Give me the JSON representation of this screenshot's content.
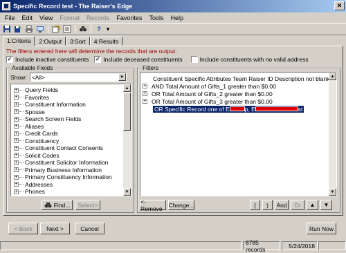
{
  "window": {
    "title": "Specific Record test - The Raiser's Edge",
    "close_glyph": "✕"
  },
  "menu": [
    {
      "label": "File",
      "enabled": true
    },
    {
      "label": "Edit",
      "enabled": true
    },
    {
      "label": "View",
      "enabled": true
    },
    {
      "label": "Format",
      "enabled": false
    },
    {
      "label": "Records",
      "enabled": false
    },
    {
      "label": "Favorites",
      "enabled": true
    },
    {
      "label": "Tools",
      "enabled": true
    },
    {
      "label": "Help",
      "enabled": true
    }
  ],
  "toolbar": {
    "icons": [
      "save-icon",
      "save-and-close-icon",
      "print-icon",
      "print-preview-icon",
      "export-icon",
      "properties-icon",
      "find-icon",
      "help-icon"
    ],
    "help_glyph": "?",
    "dropdown_glyph": "▾"
  },
  "tabs": [
    "1:Criteria",
    "2:Output",
    "3:Sort",
    "4:Results"
  ],
  "criteria": {
    "info_text": "The filters entered here will determine the records that are output.",
    "checkboxes": [
      {
        "label": "Include inactive constituents",
        "checked": true
      },
      {
        "label": "Include deceased constituents",
        "checked": true
      },
      {
        "label": "Include constituents with no valid address",
        "checked": false
      }
    ],
    "check_glyph": "✓",
    "available_fields": {
      "legend": "Available Fields",
      "show_label": "Show:",
      "show_value": "<All>",
      "expand_glyph": "+",
      "items": [
        "Query Fields",
        "Favorites",
        "Constituent Information",
        "Spouse",
        "Search Screen Fields",
        "Aliases",
        "Credit Cards",
        "Constituency",
        "Constituent Contact Consents",
        "Solicit Codes",
        "Constituent Solicitor Information",
        "Primary Business Information",
        "Primary Constituency Information",
        "Addresses",
        "Phones"
      ],
      "find_label": "Find...",
      "select_label": "Select>"
    },
    "filters": {
      "legend": "Filters",
      "rows": [
        {
          "text": "Constituent Specific Attributes Team Raiser ID Description not blank",
          "expandable": false
        },
        {
          "text": "AND Total Amount of Gifts_1 greater than $0.00",
          "expandable": true
        },
        {
          "text": "OR Total Amount of Gifts_2 greater than $0.00",
          "expandable": true
        },
        {
          "text": "OR Total Amount of Gifts_3 greater than $0.00",
          "expandable": true
        }
      ],
      "selected_row": {
        "prefix": "OR Specific Record one of E",
        "mid": "p, E",
        "suffix": "st"
      },
      "buttons": {
        "remove": "<-Remove",
        "change": "Change...",
        "open_paren": "(",
        "close_paren": ")",
        "and": "And",
        "or": "Or"
      }
    }
  },
  "nav": {
    "back": "< Back",
    "next": "Next >",
    "cancel": "Cancel",
    "run_now": "Run Now"
  },
  "status": {
    "count": "6785 records",
    "date": "5/24/2018"
  }
}
